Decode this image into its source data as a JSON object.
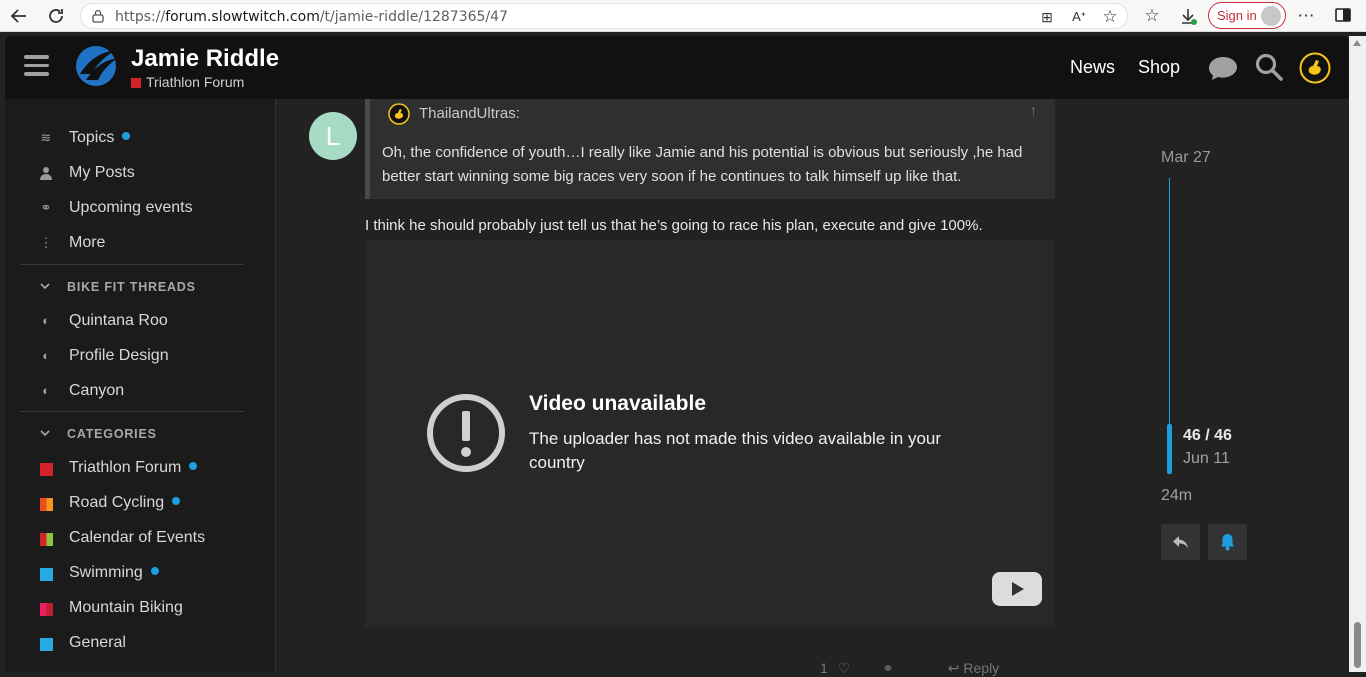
{
  "browser": {
    "url_prefix": "https://",
    "url_host": "forum.slowtwitch.com",
    "url_path": "/t/jamie-riddle/1287365/47",
    "signin_label": "Sign in"
  },
  "header": {
    "title": "Jamie Riddle",
    "subtitle": "Triathlon Forum",
    "nav": [
      "News",
      "Shop"
    ]
  },
  "sidebar": {
    "main_items": [
      {
        "label": "Topics",
        "icon": "layers-icon",
        "unread": true
      },
      {
        "label": "My Posts",
        "icon": "user-icon",
        "unread": false
      },
      {
        "label": "Upcoming events",
        "icon": "link-icon",
        "unread": false
      },
      {
        "label": "More",
        "icon": "more-vertical-icon",
        "unread": false
      }
    ],
    "bike_fit_heading": "BIKE FIT THREADS",
    "bike_fit_items": [
      {
        "label": "Quintana Roo",
        "icon": "half-circle-icon"
      },
      {
        "label": "Profile Design",
        "icon": "half-circle-icon"
      },
      {
        "label": "Canyon",
        "icon": "half-circle-icon"
      }
    ],
    "categories_heading": "CATEGORIES",
    "categories": [
      {
        "label": "Triathlon Forum",
        "colors": [
          "#d2232a"
        ],
        "unread": true
      },
      {
        "label": "Road Cycling",
        "colors": [
          "#e94e1b",
          "#f7941d"
        ],
        "unread": true
      },
      {
        "label": "Calendar of Events",
        "colors": [
          "#92278f",
          "#8dc63f"
        ],
        "unread": false
      },
      {
        "label": "Swimming",
        "colors": [
          "#25aae1"
        ],
        "unread": true
      },
      {
        "label": "Mountain Biking",
        "colors": [
          "#e91e63",
          "#bf1e2e"
        ],
        "unread": false
      },
      {
        "label": "General",
        "colors": [
          "#25aae1"
        ],
        "unread": false
      }
    ]
  },
  "post": {
    "avatar_letter": "L",
    "quote_user": "ThailandUltras:",
    "quote_text": "Oh, the confidence of youth…I really like Jamie and his potential is obvious but seriously ,he had better start winning some big races very soon if he continues to talk himself up like that.",
    "body": "I think he should probably just tell us that he’s going to race his plan, execute and give 100%.",
    "video_title": "Video unavailable",
    "video_message": "The uploader has not made this video available in your country",
    "actions": {
      "like_count": "1",
      "reply_label": "Reply"
    }
  },
  "timeline": {
    "start_date": "Mar 27",
    "progress": "46 / 46",
    "end_date": "Jun 11",
    "ago": "24m"
  },
  "colors": {
    "accent": "#1e9ee0",
    "brand_red": "#d2232a",
    "avatar_bg": "#a8dbc6"
  }
}
